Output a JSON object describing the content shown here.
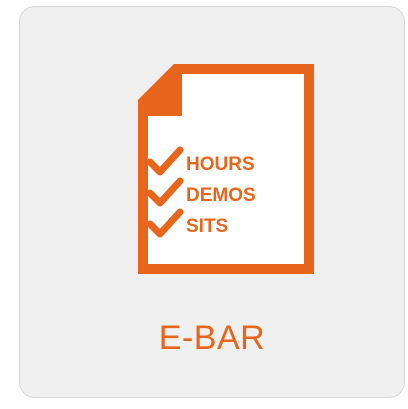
{
  "tile": {
    "label": "E-BAR",
    "icon": "checklist-document-icon",
    "accent_color": "#e8661c",
    "background_color": "#f0f0f0",
    "checklist": [
      "HOURS",
      "DEMOS",
      "SITS"
    ]
  }
}
